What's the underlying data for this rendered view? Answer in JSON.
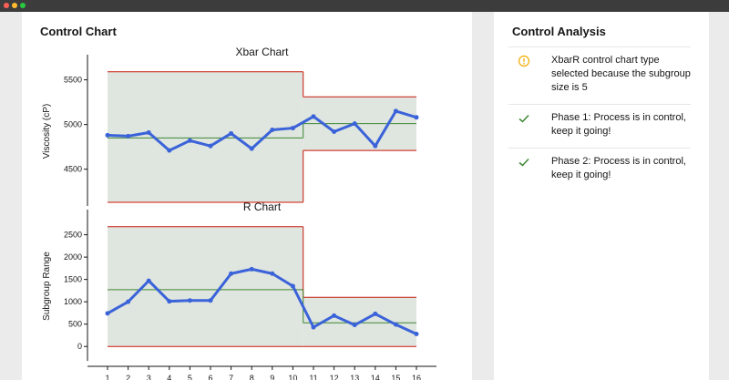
{
  "window": {
    "controls": [
      "close",
      "minimize",
      "maximize"
    ]
  },
  "left_panel": {
    "title": "Control Chart"
  },
  "right_panel": {
    "title": "Control Analysis",
    "items": [
      {
        "icon": "info-circle-icon",
        "icon_color": "#f0ab00",
        "text": "XbarR control chart type selected because the subgroup size is 5"
      },
      {
        "icon": "check-icon",
        "icon_color": "#3e8635",
        "text": "Phase 1: Process is in control, keep it going!"
      },
      {
        "icon": "check-icon",
        "icon_color": "#3e8635",
        "text": "Phase 2: Process is in control, keep it going!"
      }
    ]
  },
  "chart_data": [
    {
      "type": "line",
      "title": "Xbar Chart",
      "ylabel": "Viscosity (cP)",
      "xlabel": "",
      "x": [
        1,
        2,
        3,
        4,
        5,
        6,
        7,
        8,
        9,
        10,
        11,
        12,
        13,
        14,
        15,
        16
      ],
      "values": [
        4880,
        4870,
        4910,
        4710,
        4820,
        4760,
        4900,
        4730,
        4940,
        4960,
        5090,
        4920,
        5010,
        4760,
        5150,
        5080
      ],
      "yticks": [
        4500,
        5000,
        5500
      ],
      "ylim": [
        4150,
        5700
      ],
      "phases": [
        {
          "x_start": 1,
          "x_end": 10.5,
          "ucl": 5590,
          "cl": 4850,
          "lcl": 4130
        },
        {
          "x_start": 10.5,
          "x_end": 16,
          "ucl": 5310,
          "cl": 5010,
          "lcl": 4710
        }
      ],
      "colors": {
        "series": "#3b63d9",
        "limits": "#c9190b",
        "center": "#3e8635",
        "band": "#dfe5df"
      }
    },
    {
      "type": "line",
      "title": "R Chart",
      "ylabel": "Subgroup Range",
      "xlabel": "",
      "x": [
        1,
        2,
        3,
        4,
        5,
        6,
        7,
        8,
        9,
        10,
        11,
        12,
        13,
        14,
        15,
        16
      ],
      "x_tick_labels": [
        "1",
        "2",
        "3",
        "4",
        "5",
        "6",
        "7",
        "8",
        "9",
        "10",
        "11",
        "12",
        "13",
        "14",
        "15",
        "16"
      ],
      "values": [
        740,
        1000,
        1470,
        1010,
        1030,
        1030,
        1630,
        1730,
        1630,
        1350,
        430,
        690,
        480,
        730,
        490,
        280
      ],
      "yticks": [
        0,
        500,
        1000,
        1500,
        2000,
        2500
      ],
      "ylim": [
        -200,
        2900
      ],
      "phases": [
        {
          "x_start": 1,
          "x_end": 10.5,
          "ucl": 2680,
          "cl": 1270,
          "lcl": 0
        },
        {
          "x_start": 10.5,
          "x_end": 16,
          "ucl": 1100,
          "cl": 530,
          "lcl": 0
        }
      ],
      "colors": {
        "series": "#3b63d9",
        "limits": "#c9190b",
        "center": "#3e8635",
        "band": "#dfe5df"
      }
    }
  ]
}
